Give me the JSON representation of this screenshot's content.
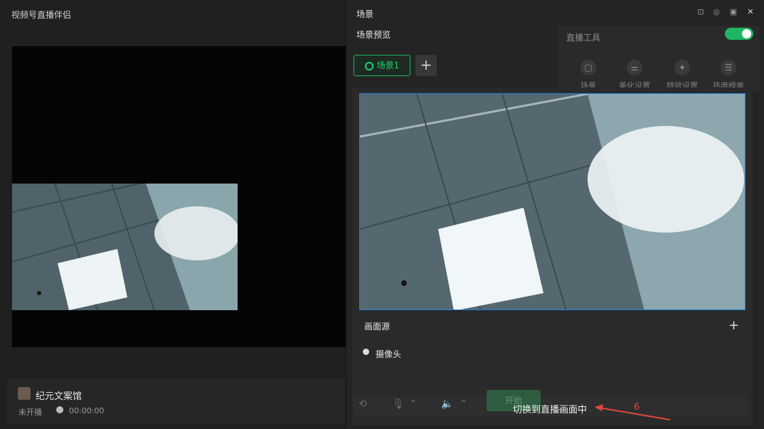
{
  "main_window": {
    "title": "视频号直播伴侣",
    "account_name": "纪元文案馆",
    "status": "未开播",
    "timer": "00:00:00"
  },
  "scene_panel": {
    "title": "场景",
    "preview_label": "场景预览",
    "scene_tab": "场景1",
    "add_scene": "+",
    "sources_label": "画面源",
    "add_source": "+",
    "camera_source": "摄像头"
  },
  "live_tools": {
    "label": "直播工具",
    "toggle_on": true,
    "items": [
      {
        "label": "场景",
        "icon": "scene-icon"
      },
      {
        "label": "美化设置",
        "icon": "sliders-icon"
      },
      {
        "label": "特效设置",
        "icon": "sparkle-icon"
      },
      {
        "label": "热度榜单",
        "icon": "list-icon"
      }
    ]
  },
  "bottom_bar": {
    "start_label": "开始",
    "switch_text": "切换到直播画面中",
    "annotation_number": "6"
  },
  "colors": {
    "accent_green": "#1fb563",
    "selection_blue": "#1e7fe6",
    "annotation_red": "#e0483e"
  }
}
